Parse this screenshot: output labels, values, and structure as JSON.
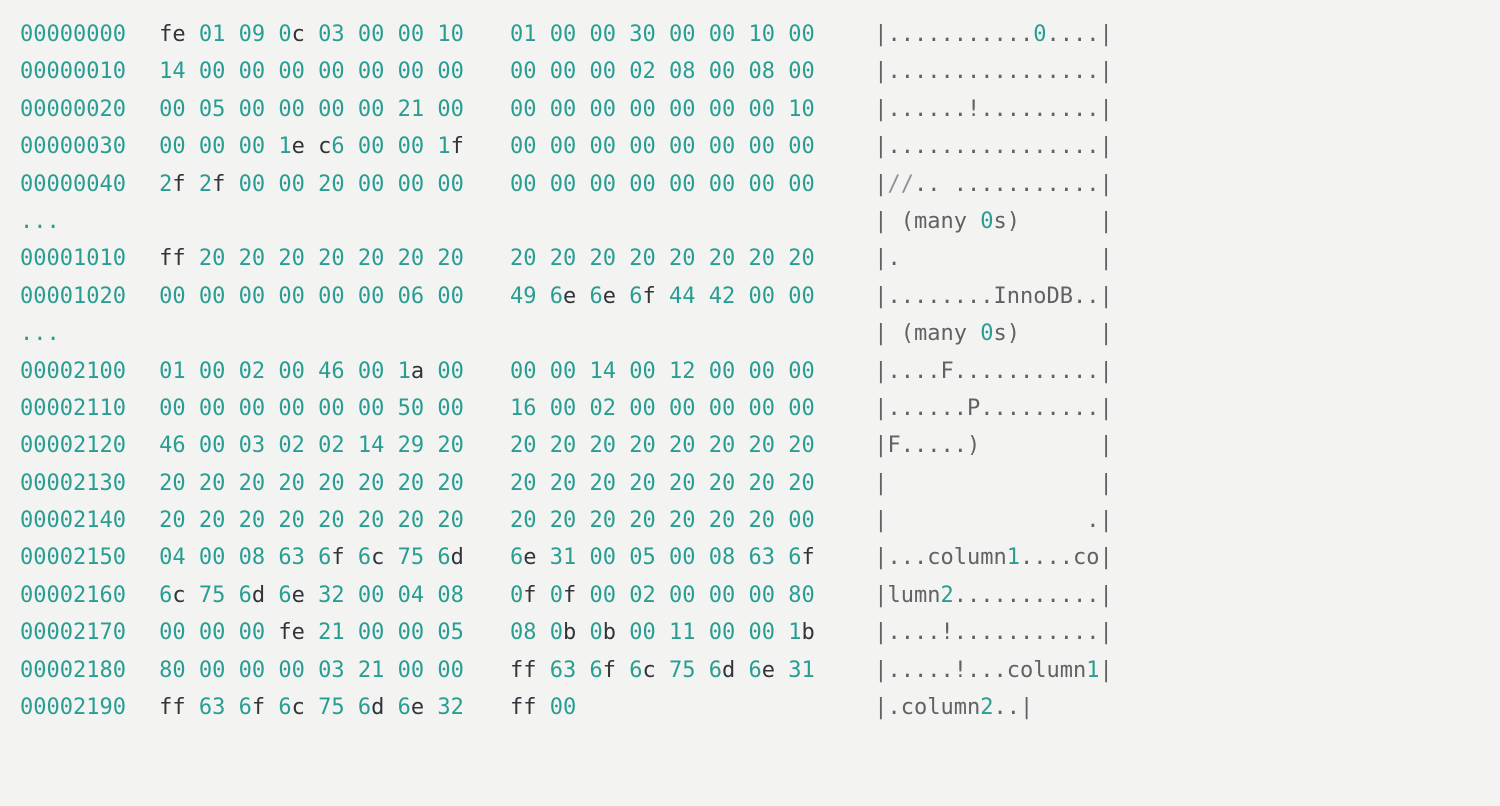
{
  "rows": [
    {
      "offset": "00000000",
      "hex1": "fe 01 09 0c 03 00 00 10",
      "hex2": "01 00 00 30 00 00 10 00",
      "ascii": "|...........0....|"
    },
    {
      "offset": "00000010",
      "hex1": "14 00 00 00 00 00 00 00",
      "hex2": "00 00 00 02 08 00 08 00",
      "ascii": "|................|"
    },
    {
      "offset": "00000020",
      "hex1": "00 05 00 00 00 00 21 00",
      "hex2": "00 00 00 00 00 00 00 10",
      "ascii": "|......!.........|"
    },
    {
      "offset": "00000030",
      "hex1": "00 00 00 1e c6 00 00 1f",
      "hex2": "00 00 00 00 00 00 00 00",
      "ascii": "|................|"
    },
    {
      "offset": "00000040",
      "hex1": "2f 2f 00 00 20 00 00 00",
      "hex2": "00 00 00 00 00 00 00 00",
      "ascii": "|//.. ...........|"
    },
    {
      "offset": "...",
      "hex1": "",
      "hex2": "",
      "ascii": "| (many 0s)      |"
    },
    {
      "offset": "00001010",
      "hex1": "ff 20 20 20 20 20 20 20",
      "hex2": "20 20 20 20 20 20 20 20",
      "ascii": "|.               |"
    },
    {
      "offset": "00001020",
      "hex1": "00 00 00 00 00 00 06 00",
      "hex2": "49 6e 6e 6f 44 42 00 00",
      "ascii": "|........InnoDB..|"
    },
    {
      "offset": "...",
      "hex1": "",
      "hex2": "",
      "ascii": "| (many 0s)      |"
    },
    {
      "offset": "00002100",
      "hex1": "01 00 02 00 46 00 1a 00",
      "hex2": "00 00 14 00 12 00 00 00",
      "ascii": "|....F...........|"
    },
    {
      "offset": "00002110",
      "hex1": "00 00 00 00 00 00 50 00",
      "hex2": "16 00 02 00 00 00 00 00",
      "ascii": "|......P.........|"
    },
    {
      "offset": "00002120",
      "hex1": "46 00 03 02 02 14 29 20",
      "hex2": "20 20 20 20 20 20 20 20",
      "ascii": "|F.....)         |"
    },
    {
      "offset": "00002130",
      "hex1": "20 20 20 20 20 20 20 20",
      "hex2": "20 20 20 20 20 20 20 20",
      "ascii": "|                |"
    },
    {
      "offset": "00002140",
      "hex1": "20 20 20 20 20 20 20 20",
      "hex2": "20 20 20 20 20 20 20 00",
      "ascii": "|               .|"
    },
    {
      "offset": "00002150",
      "hex1": "04 00 08 63 6f 6c 75 6d",
      "hex2": "6e 31 00 05 00 08 63 6f",
      "ascii": "|...column1....co|"
    },
    {
      "offset": "00002160",
      "hex1": "6c 75 6d 6e 32 00 04 08",
      "hex2": "0f 0f 00 02 00 00 00 80",
      "ascii": "|lumn2...........|"
    },
    {
      "offset": "00002170",
      "hex1": "00 00 00 fe 21 00 00 05",
      "hex2": "08 0b 0b 00 11 00 00 1b",
      "ascii": "|....!...........|"
    },
    {
      "offset": "00002180",
      "hex1": "80 00 00 00 03 21 00 00",
      "hex2": "ff 63 6f 6c 75 6d 6e 31",
      "ascii": "|.....!...column1|"
    },
    {
      "offset": "00002190",
      "hex1": "ff 63 6f 6c 75 6d 6e 32",
      "hex2": "ff 00",
      "ascii": "|.column2..|"
    }
  ]
}
